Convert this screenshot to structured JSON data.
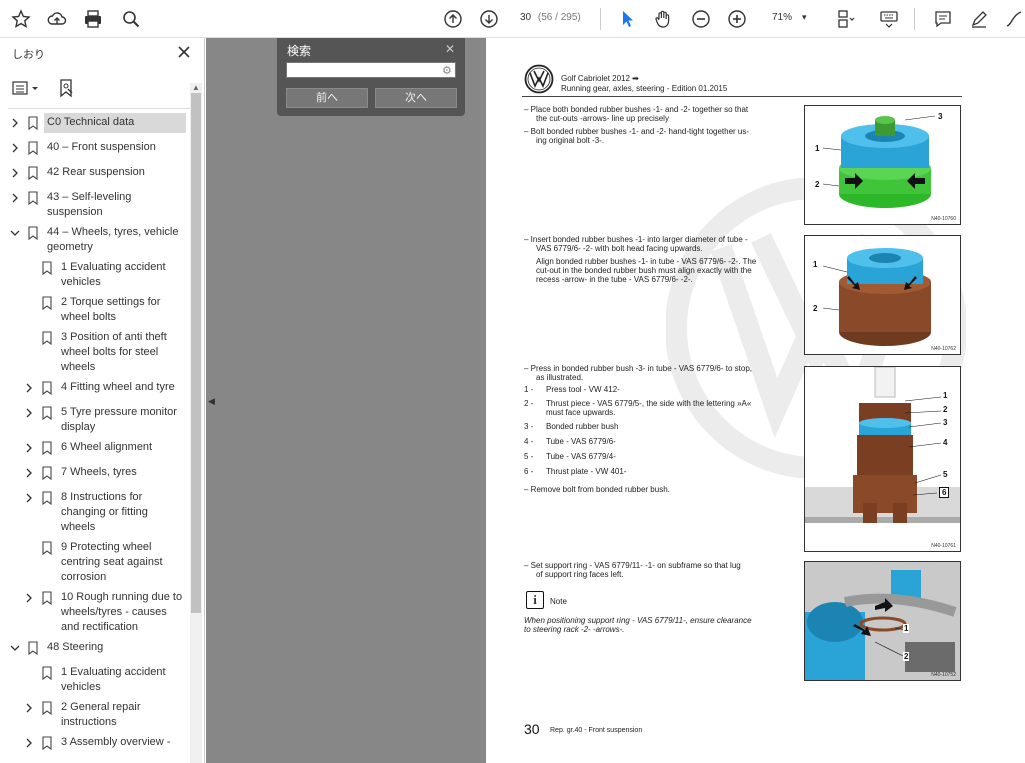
{
  "toolbar": {
    "page_current": "30",
    "page_total": "(56 / 295)",
    "zoom": "71%",
    "zoom_dropdown": "▾"
  },
  "sidebar": {
    "title": "しおり",
    "items": [
      {
        "label": "C0 Technical data",
        "chev": ">",
        "selected": true
      },
      {
        "label": "40 – Front suspension",
        "chev": ">"
      },
      {
        "label": "42 Rear suspension",
        "chev": ">"
      },
      {
        "label": "43 – Self-leveling suspension",
        "chev": ">"
      },
      {
        "label": "44 – Wheels, tyres, vehicle geometry",
        "chev": "v"
      },
      {
        "label": "1 Evaluating accident vehicles"
      },
      {
        "label": "2 Torque settings for wheel bolts"
      },
      {
        "label": "3 Position of anti theft wheel bolts for steel wheels"
      },
      {
        "label": "4 Fitting wheel and tyre",
        "chev": ">"
      },
      {
        "label": "5 Tyre pressure monitor display",
        "chev": ">"
      },
      {
        "label": "6 Wheel alignment",
        "chev": ">"
      },
      {
        "label": "7 Wheels, tyres",
        "chev": ">"
      },
      {
        "label": "8 Instructions for changing or fitting wheels",
        "chev": ">"
      },
      {
        "label": "9 Protecting wheel centring seat against corrosion"
      },
      {
        "label": "10 Rough running due to wheels/tyres - causes and rectification",
        "chev": ">"
      },
      {
        "label": "48 Steering",
        "chev": "v"
      },
      {
        "label": "1 Evaluating accident vehicles"
      },
      {
        "label": "2 General repair instructions",
        "chev": ">"
      },
      {
        "label": "3 Assembly overview -",
        "chev": ">"
      }
    ]
  },
  "search": {
    "title": "検索",
    "value": "",
    "prev_label": "前へ",
    "next_label": "次へ"
  },
  "document": {
    "header_line1": "Golf Cabriolet 2012 ➡",
    "header_line2": "Running gear, axles, steering - Edition 01.2015",
    "block1_line1": "–  Place both bonded rubber bushes -1- and -2- together so that",
    "block1_line2": "the cut-outs -arrows- line up precisely",
    "block1_line3": "–  Bolt bonded rubber bushes -1- and -2- hand-tight together us-",
    "block1_line4": "ing original bolt -3-.",
    "block2_line1": "–  Insert bonded rubber bushes -1- into larger diameter of tube -",
    "block2_line2": "VAS 6779/6- -2- with bolt head facing upwards.",
    "block2_line3": "Align bonded rubber bushes -1- in tube - VAS 6779/6- -2-. The",
    "block2_line4": "cut-out in the bonded rubber bush must align exactly with the",
    "block2_line5": "recess -arrow- in the tube - VAS 6779/6- -2-.",
    "block3_line1": "–  Press in bonded rubber bush -3- in tube - VAS 6779/6- to stop,",
    "block3_line2": "as illustrated.",
    "list": [
      {
        "n": "1 -",
        "t": "Press tool - VW 412-"
      },
      {
        "n": "2 -",
        "t": "Thrust piece - VAS 6779/5-, the side with the lettering »A«"
      },
      {
        "n": "",
        "t": "must face upwards."
      },
      {
        "n": "3 -",
        "t": "Bonded rubber bush"
      },
      {
        "n": "4 -",
        "t": "Tube - VAS 6779/6-"
      },
      {
        "n": "5 -",
        "t": "Tube - VAS 6779/4-"
      },
      {
        "n": "6 -",
        "t": "Thrust plate - VW 401-"
      }
    ],
    "block3_last": "–  Remove bolt from bonded rubber bush.",
    "block4_line1": "–  Set support ring - VAS 6779/11- -1- on subframe so that lug",
    "block4_line2": "of support ring faces left.",
    "note_label": "Note",
    "note_line1": "When positioning support ring - VAS 6779/11-, ensure clearance",
    "note_line2": "to steering rack -2- -arrows-.",
    "page_number": "30",
    "footer": "Rep. gr.40 - Front suspension",
    "fig1_code": "N40-10760",
    "fig2_code": "N40-10762",
    "fig3_code": "N40-10761",
    "fig4_code": "N40-10752"
  },
  "colors": {
    "accent_blue": "#1877f2",
    "sidebar_selected": "#d9d9d9",
    "gray_area": "#878787",
    "bush_blue": "#2aa3d6",
    "bush_green": "#3fc43a",
    "tube_brown": "#8a4a2a"
  }
}
